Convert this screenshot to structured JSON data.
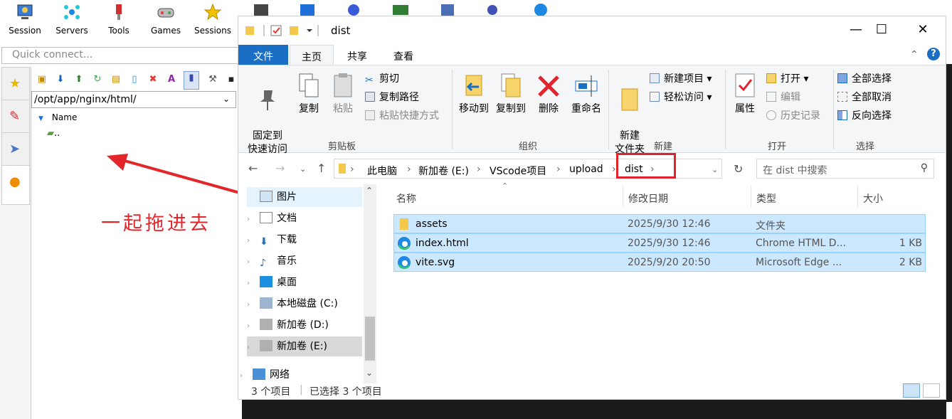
{
  "moba": {
    "toolbar": [
      {
        "label": "Session",
        "icon": "session-icon"
      },
      {
        "label": "Servers",
        "icon": "servers-icon"
      },
      {
        "label": "Tools",
        "icon": "tools-icon"
      },
      {
        "label": "Games",
        "icon": "games-icon"
      },
      {
        "label": "Sessions",
        "icon": "sessions-star-icon"
      }
    ],
    "quick_connect_placeholder": "Quick connect...",
    "sftp_path": "/opt/app/nginx/html/",
    "name_column": "Name",
    "parent_dir": ".."
  },
  "annotation": "一起拖进去",
  "explorer": {
    "title": "dist",
    "tabs": [
      "文件",
      "主页",
      "共享",
      "查看"
    ],
    "ribbon": {
      "clipboard": {
        "pin": "固定到\n快速访问",
        "copy": "复制",
        "paste": "粘贴",
        "cut": "剪切",
        "copy_path": "复制路径",
        "paste_shortcut": "粘贴快捷方式",
        "label": "剪贴板"
      },
      "organize": {
        "move_to": "移动到",
        "copy_to": "复制到",
        "delete": "删除",
        "rename": "重命名",
        "label": "组织"
      },
      "new": {
        "new_folder": "新建\n文件夹",
        "new_item": "新建项目",
        "easy_access": "轻松访问",
        "label": "新建"
      },
      "open": {
        "properties": "属性",
        "open": "打开",
        "edit": "编辑",
        "history": "历史记录",
        "label": "打开"
      },
      "select": {
        "select_all": "全部选择",
        "select_none": "全部取消",
        "invert": "反向选择",
        "label": "选择"
      }
    },
    "breadcrumbs": [
      "此电脑",
      "新加卷 (E:)",
      "VScode项目",
      "upload",
      "dist"
    ],
    "search_placeholder": "在 dist 中搜索",
    "nav": [
      "图片",
      "文档",
      "下载",
      "音乐",
      "桌面",
      "本地磁盘 (C:)",
      "新加卷 (D:)",
      "新加卷 (E:)",
      "网络"
    ],
    "columns": {
      "name": "名称",
      "date": "修改日期",
      "type": "类型",
      "size": "大小"
    },
    "files": [
      {
        "name": "assets",
        "date": "2025/9/30 12:46",
        "type": "文件夹",
        "size": ""
      },
      {
        "name": "index.html",
        "date": "2025/9/30 12:46",
        "type": "Chrome HTML D...",
        "size": "1 KB"
      },
      {
        "name": "vite.svg",
        "date": "2025/9/20 20:50",
        "type": "Microsoft Edge ...",
        "size": "2 KB"
      }
    ],
    "status": {
      "count": "3 个项目",
      "selected": "已选择 3 个项目"
    }
  }
}
